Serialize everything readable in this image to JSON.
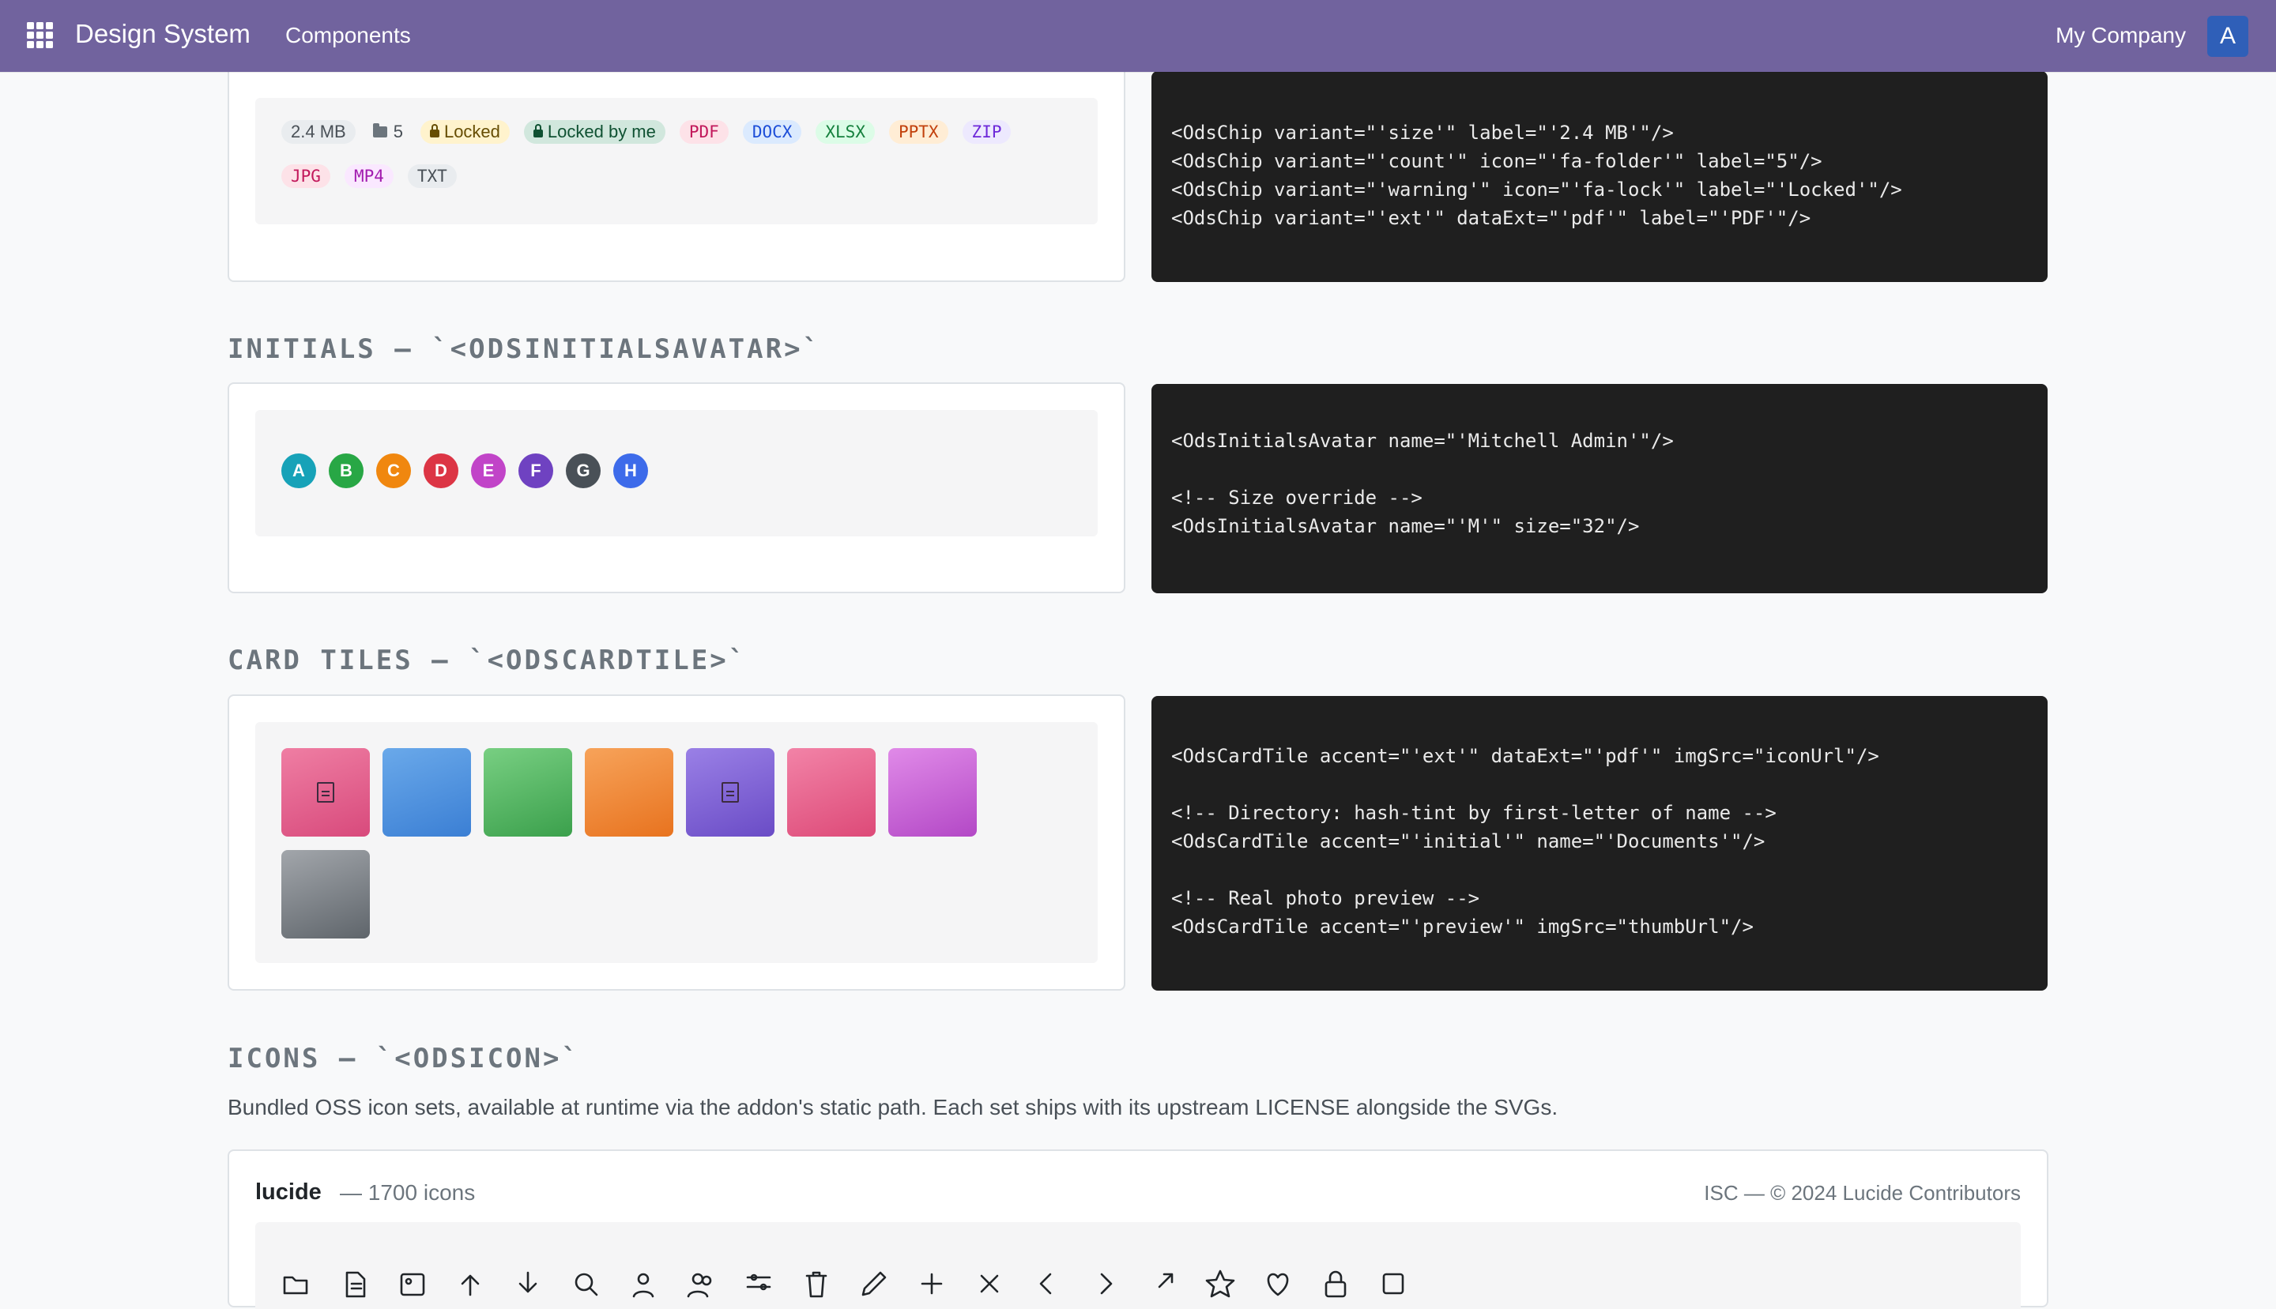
{
  "navbar": {
    "brand": "Design System",
    "nav_link": "Components",
    "company": "My Company",
    "avatar_initial": "A"
  },
  "chips_section": {
    "chips_row1": [
      {
        "kind": "size",
        "label": "2.4 MB"
      },
      {
        "kind": "count",
        "label": "5",
        "icon": "folder-icon"
      },
      {
        "kind": "warning",
        "label": "Locked",
        "icon": "lock-icon"
      },
      {
        "kind": "mine",
        "label": "Locked by me",
        "icon": "lock-icon"
      },
      {
        "kind": "ext",
        "label": "PDF",
        "bg": "#fde2e8",
        "fg": "#c2185b"
      },
      {
        "kind": "ext",
        "label": "DOCX",
        "bg": "#dbeafe",
        "fg": "#1d4ed8"
      },
      {
        "kind": "ext",
        "label": "XLSX",
        "bg": "#dcfce7",
        "fg": "#15803d"
      },
      {
        "kind": "ext",
        "label": "PPTX",
        "bg": "#ffedd5",
        "fg": "#c2410c"
      },
      {
        "kind": "ext",
        "label": "ZIP",
        "bg": "#ede9fe",
        "fg": "#6d28d9"
      }
    ],
    "chips_row2": [
      {
        "kind": "ext",
        "label": "JPG",
        "bg": "#fde2e8",
        "fg": "#c2185b"
      },
      {
        "kind": "ext",
        "label": "MP4",
        "bg": "#fae8ff",
        "fg": "#a21caf"
      },
      {
        "kind": "ext",
        "label": "TXT",
        "bg": "#e9ecef",
        "fg": "#495057"
      }
    ],
    "code_lines": [
      "<OdsChip variant=\"'size'\" label=\"'2.4 MB'\"/>",
      "<OdsChip variant=\"'count'\" icon=\"'fa-folder'\" label=\"5\"/>",
      "<OdsChip variant=\"'warning'\" icon=\"'fa-lock'\" label=\"'Locked'\"/>",
      "<OdsChip variant=\"'ext'\" dataExt=\"'pdf'\" label=\"'PDF'\"/>"
    ]
  },
  "initials_section": {
    "title": "INITIALS — `<ODSINITIALSAVATAR>`",
    "avatars": [
      {
        "letter": "A",
        "color": "#17a2b8"
      },
      {
        "letter": "B",
        "color": "#28a745"
      },
      {
        "letter": "C",
        "color": "#f0870f"
      },
      {
        "letter": "D",
        "color": "#dc3545"
      },
      {
        "letter": "E",
        "color": "#c144c8"
      },
      {
        "letter": "F",
        "color": "#6f42c1"
      },
      {
        "letter": "G",
        "color": "#495057"
      },
      {
        "letter": "H",
        "color": "#3d6bea"
      }
    ],
    "code_lines": [
      "<OdsInitialsAvatar name=\"'Mitchell Admin'\"/>",
      "",
      "<!-- Size override -->",
      "<OdsInitialsAvatar name=\"'M'\" size=\"32\"/>"
    ]
  },
  "cardtiles_section": {
    "title": "CARD TILES — `<ODSCARDTILE>`",
    "tiles": [
      {
        "from": "#ef7ea3",
        "to": "#d84a7c",
        "icon": "pdf-file-icon"
      },
      {
        "from": "#6aa9ea",
        "to": "#3b7fd4",
        "icon": ""
      },
      {
        "from": "#78cf82",
        "to": "#3ba04c",
        "icon": ""
      },
      {
        "from": "#f7a35a",
        "to": "#e8731f",
        "icon": ""
      },
      {
        "from": "#9a80e6",
        "to": "#6a4cc6",
        "icon": "file-icon"
      },
      {
        "from": "#f283a7",
        "to": "#dd4a78",
        "icon": ""
      },
      {
        "from": "#e08ae8",
        "to": "#b348c6",
        "icon": ""
      },
      {
        "from": "#a2a6ab",
        "to": "#5f656b",
        "icon": ""
      }
    ],
    "code_lines": [
      "<OdsCardTile accent=\"'ext'\" dataExt=\"'pdf'\" imgSrc=\"iconUrl\"/>",
      "",
      "<!-- Directory: hash-tint by first-letter of name -->",
      "<OdsCardTile accent=\"'initial'\" name=\"'Documents'\"/>",
      "",
      "<!-- Real photo preview -->",
      "<OdsCardTile accent=\"'preview'\" imgSrc=\"thumbUrl\"/>"
    ]
  },
  "icons_section": {
    "title": "ICONS — `<ODSICON>`",
    "description": "Bundled OSS icon sets, available at runtime via the addon's static path. Each set ships with its upstream LICENSE alongside the SVGs.",
    "set_name": "lucide",
    "set_count": "— 1700 icons",
    "set_license": "ISC — © 2024 Lucide Contributors",
    "icons": [
      "folder-open-icon",
      "file-text-icon",
      "image-icon",
      "arrow-up-icon",
      "arrow-down-icon",
      "search-icon",
      "user-icon",
      "users-icon",
      "sliders-icon",
      "trash-icon",
      "pencil-icon",
      "plus-icon",
      "x-icon",
      "chevron-left-icon",
      "chevron-right-icon",
      "external-link-icon",
      "star-icon",
      "heart-icon",
      "lock-icon",
      "square-icon"
    ]
  }
}
